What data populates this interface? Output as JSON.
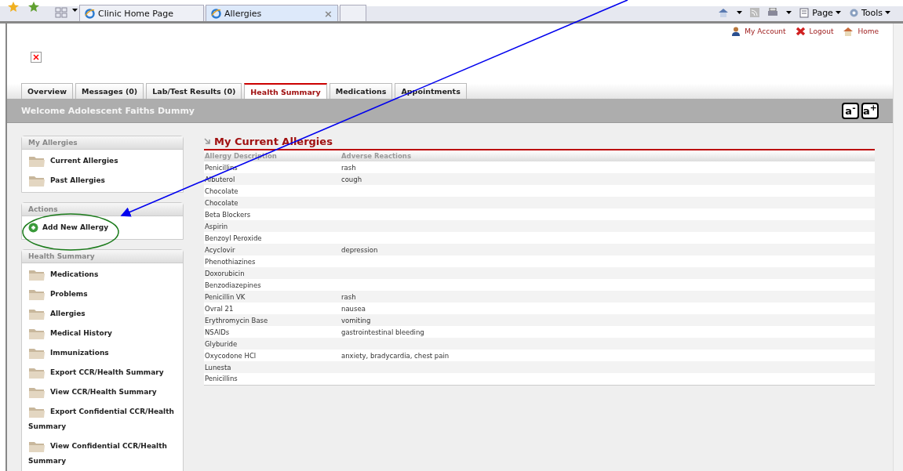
{
  "browser": {
    "tabs": [
      {
        "label": "Clinic Home Page",
        "selected": false
      },
      {
        "label": "Allergies",
        "selected": true
      }
    ],
    "tab_close": "×",
    "tools": [
      {
        "label": "Page",
        "kind": "page"
      },
      {
        "label": "Tools",
        "kind": "tools"
      }
    ]
  },
  "header": {
    "links": [
      {
        "label": "My Account",
        "kind": "account"
      },
      {
        "label": "Logout",
        "kind": "logout"
      },
      {
        "label": "Home",
        "kind": "home"
      }
    ]
  },
  "nav_tabs": [
    {
      "label": "Overview",
      "selected": false
    },
    {
      "label": "Messages (0)",
      "selected": false
    },
    {
      "label": "Lab/Test Results (0)",
      "selected": false
    },
    {
      "label": "Health Summary",
      "selected": true
    },
    {
      "label": "Medications",
      "selected": false
    },
    {
      "label": "Appointments",
      "selected": false
    }
  ],
  "welcome": "Welcome Adolescent Faiths Dummy",
  "font_buttons": [
    "a$^{-}$",
    "a$^{+}$"
  ],
  "sidebar": [
    {
      "title": "My Allergies",
      "items": [
        {
          "label": "Current Allergies",
          "kind": "folder"
        },
        {
          "label": "Past Allergies",
          "kind": "folder"
        }
      ]
    },
    {
      "title": "Actions",
      "items": [
        {
          "label": "Add New Allergy",
          "kind": "action"
        }
      ]
    },
    {
      "title": "Health Summary",
      "items": [
        {
          "label": "Medications",
          "kind": "folder"
        },
        {
          "label": "Problems",
          "kind": "folder"
        },
        {
          "label": "Allergies",
          "kind": "folder"
        },
        {
          "label": "Medical History",
          "kind": "folder"
        },
        {
          "label": "Immunizations",
          "kind": "folder"
        },
        {
          "label": "Export CCR/Health Summary",
          "kind": "folder"
        },
        {
          "label": "View CCR/Health Summary",
          "kind": "folder"
        },
        {
          "label": "Export Confidential CCR/Health Summary",
          "kind": "folder"
        },
        {
          "label": "View Confidential CCR/Health Summary",
          "kind": "folder"
        }
      ]
    }
  ],
  "allergies": {
    "title": "My Current Allergies",
    "columns": [
      "Allergy Description",
      "Adverse Reactions"
    ],
    "rows": [
      [
        "Penicillins",
        "rash"
      ],
      [
        "Albuterol",
        "cough"
      ],
      [
        "Chocolate",
        ""
      ],
      [
        "Chocolate",
        ""
      ],
      [
        "Beta Blockers",
        ""
      ],
      [
        "Aspirin",
        ""
      ],
      [
        "Benzoyl Peroxide",
        ""
      ],
      [
        "Acyclovir",
        "depression"
      ],
      [
        "Phenothiazines",
        ""
      ],
      [
        "Doxorubicin",
        ""
      ],
      [
        "Benzodiazepines",
        ""
      ],
      [
        "Penicillin VK",
        "rash"
      ],
      [
        "Ovral 21",
        "nausea"
      ],
      [
        "Erythromycin Base",
        "vomiting"
      ],
      [
        "NSAIDs",
        "gastrointestinal bleeding"
      ],
      [
        "Glyburide",
        ""
      ],
      [
        "Oxycodone HCl",
        "anxiety, bradycardia, chest pain"
      ],
      [
        "Lunesta",
        ""
      ],
      [
        "Penicillins",
        ""
      ]
    ]
  }
}
